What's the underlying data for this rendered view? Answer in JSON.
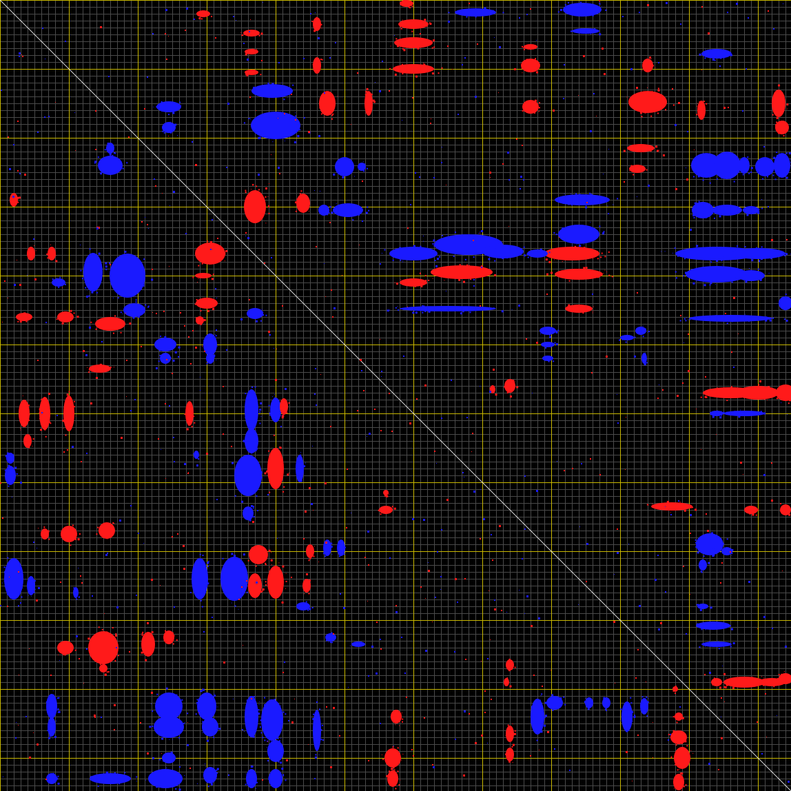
{
  "view": {
    "name": "contact-map-plot",
    "background_color": "#000000",
    "minor_grid_color": "#4a4a4a",
    "major_grid_color": "#c9b800",
    "diagonal_color": "#d8d8d8",
    "positive_color": "#ff1a1a",
    "negative_color": "#1a1aff"
  }
}
